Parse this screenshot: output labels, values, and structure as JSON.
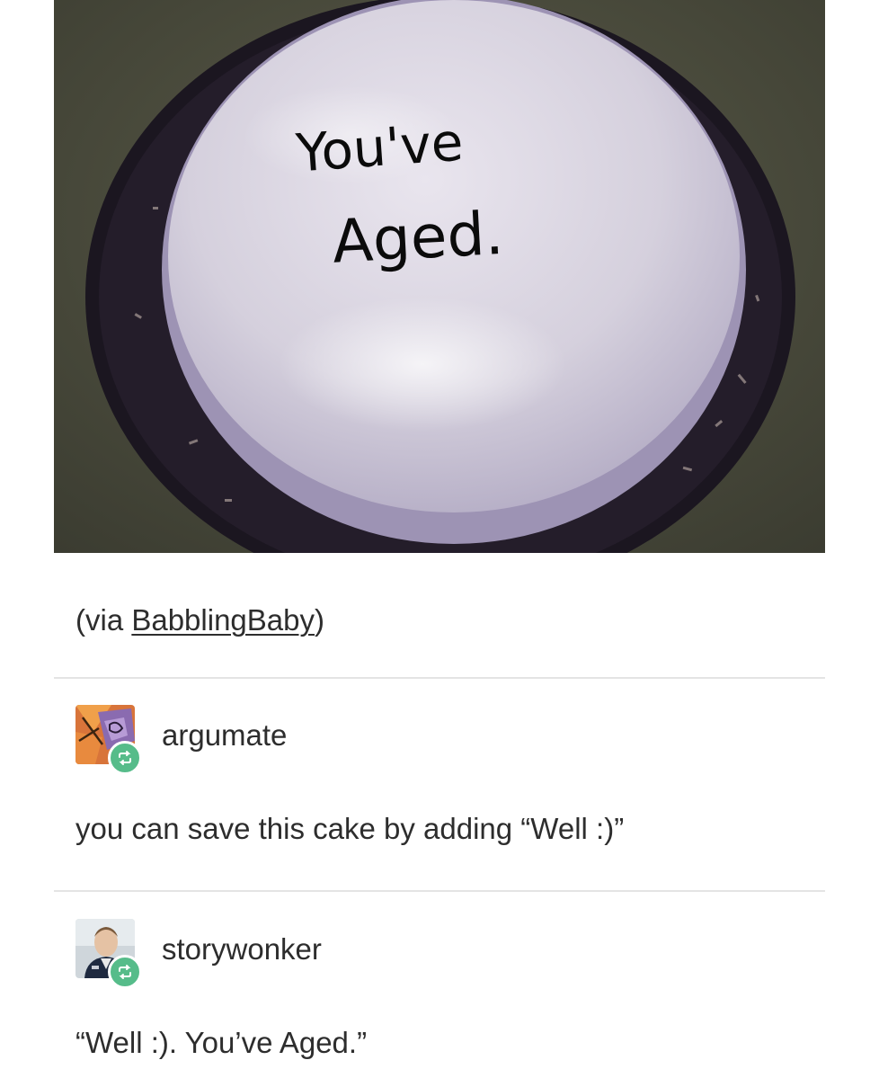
{
  "post": {
    "image": {
      "subject": "cake",
      "cake_text_line1": "You've",
      "cake_text_line2": "Aged."
    },
    "source": {
      "prefix": "(via ",
      "name": "BabblingBaby",
      "suffix": ")"
    },
    "reblogs": [
      {
        "username": "argumate",
        "comment": "you can save this cake by adding “Well :)”",
        "badge_icon": "reblog-icon",
        "badge_color": "#56bc8a"
      },
      {
        "username": "storywonker",
        "comment": "“Well :). You’ve Aged.”",
        "badge_icon": "reblog-icon",
        "badge_color": "#56bc8a"
      }
    ]
  }
}
